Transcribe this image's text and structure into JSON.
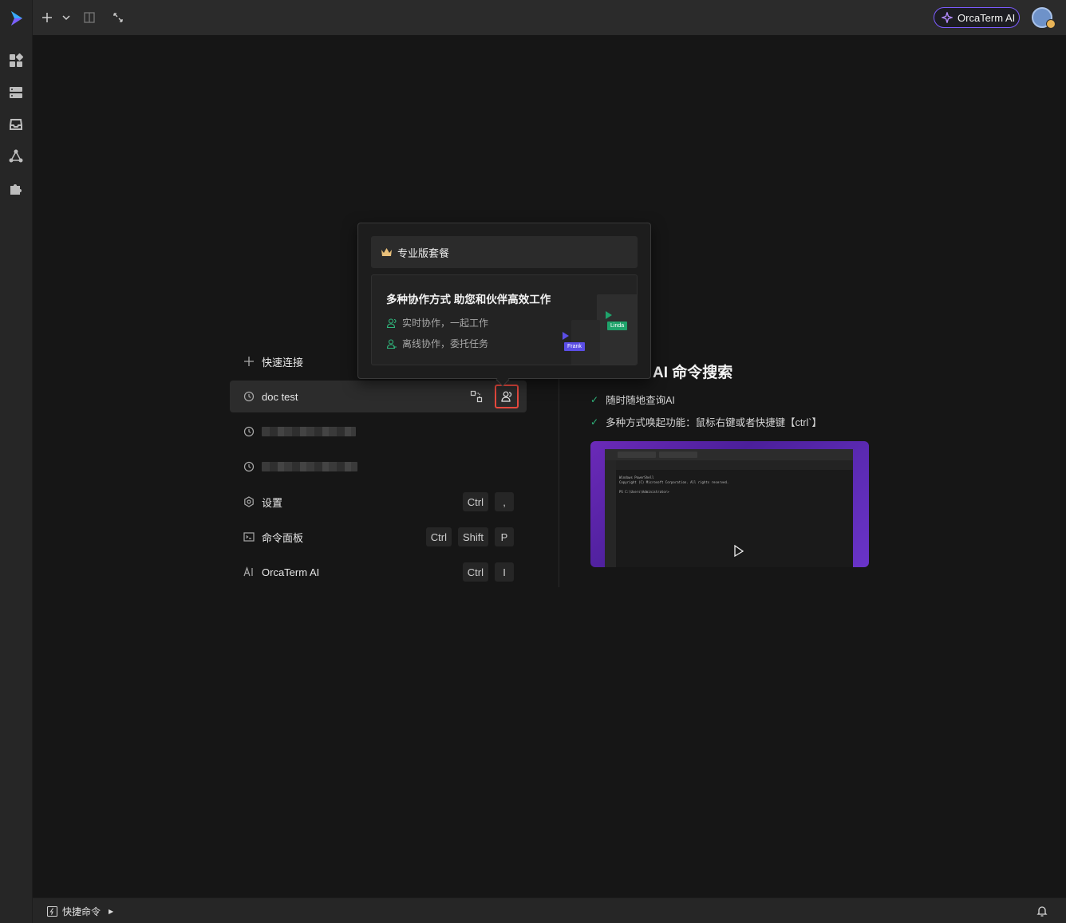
{
  "topbar": {
    "ai_label": "OrcaTerm AI"
  },
  "sidebar": {
    "items": [
      "grid-icon",
      "server-icon",
      "inbox-icon",
      "network-icon",
      "puzzle-icon"
    ]
  },
  "menu": {
    "quick_connect": "快速连接",
    "recent": [
      {
        "label": "doc test"
      },
      {
        "label": ""
      },
      {
        "label": ""
      }
    ],
    "settings": {
      "label": "设置",
      "keys": [
        "Ctrl",
        ","
      ]
    },
    "command_palette": {
      "label": "命令面板",
      "keys": [
        "Ctrl",
        "Shift",
        "P"
      ]
    },
    "orcaterm_ai": {
      "label": "OrcaTerm AI",
      "keys": [
        "Ctrl",
        "I"
      ]
    }
  },
  "popover": {
    "header": "专业版套餐",
    "title": "多种协作方式 助您和伙伴高效工作",
    "features": [
      "实时协作，一起工作",
      "离线协作，委托任务"
    ],
    "tags": [
      "Linda",
      "Frank"
    ]
  },
  "info": {
    "title": "AI 命令搜索",
    "items": [
      "随时随地查询AI",
      "多种方式唤起功能：鼠标右键或者快捷键【ctrl`】"
    ],
    "preview_lines": [
      "Windows PowerShell",
      "Copyright (C) Microsoft Corporation. All rights reserved.",
      "PS C:\\Users\\Administrator>"
    ]
  },
  "bottombar": {
    "quick_commands": "快捷命令"
  },
  "colors": {
    "accent": "#7c5cff",
    "highlight": "#e5483d",
    "check": "#2fb67c",
    "tag_linda": "#1fa36b",
    "tag_frank": "#5b4ee6"
  }
}
